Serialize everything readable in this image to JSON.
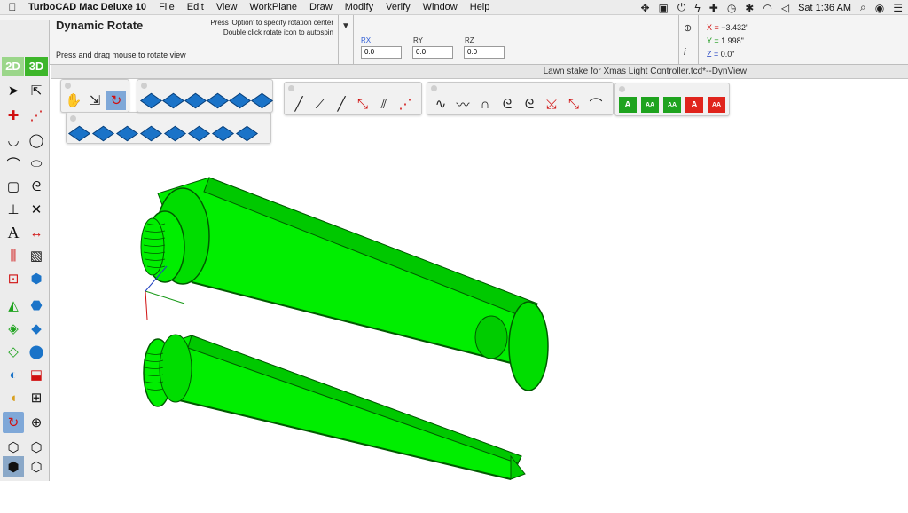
{
  "menubar": {
    "apple": "",
    "app_name": "TurboCAD Mac Deluxe 10",
    "items": [
      "File",
      "Edit",
      "View",
      "WorkPlane",
      "Draw",
      "Modify",
      "Verify",
      "Window",
      "Help"
    ],
    "clock": "Sat 1:36 AM"
  },
  "tool": {
    "title": "Dynamic Rotate",
    "hint_line1": "Press 'Option' to specify rotation center",
    "hint_line2": "Double click rotate icon to autospin",
    "instruction": "Press and drag mouse to rotate view"
  },
  "rotation": {
    "rx_label": "RX",
    "rx_value": "0.0",
    "ry_label": "RY",
    "ry_value": "0.0",
    "rz_label": "RZ",
    "rz_value": "0.0"
  },
  "coords": {
    "x_label": "X =",
    "x_value": "−3.432\"",
    "y_label": "Y =",
    "y_value": "1.998\"",
    "z_label": "Z =",
    "z_value": "0.0\""
  },
  "window": {
    "title": "Lawn stake for Xmas Light Controller.tcd*--DynView"
  },
  "modes": {
    "twod": "2D",
    "threed": "3D"
  },
  "colors": {
    "model_green": "#00ee00",
    "model_edge": "#005a00",
    "axis_x": "#d01010",
    "axis_y": "#1a9a1a",
    "axis_z": "#2040c0"
  },
  "icons": {
    "left": [
      "arrow-select-icon",
      "node-select-icon",
      "point-icon",
      "line-icon",
      "arc-icon",
      "circle-icon",
      "curve-icon",
      "ellipse-icon",
      "rectangle-icon",
      "spiral-icon",
      "trim-icon",
      "cross-icon",
      "text-icon",
      "dimension-icon",
      "hatch-icon",
      "polygon-icon",
      "extrude-icon",
      "cone-icon",
      "cylinder-icon",
      "loft-icon",
      "box-icon",
      "revolve-icon",
      "boolean-icon",
      "render-icon",
      "layers-icon",
      "rotate-view-icon",
      "zoom-icon",
      "wireframe-icon",
      "shaded-icon"
    ]
  }
}
